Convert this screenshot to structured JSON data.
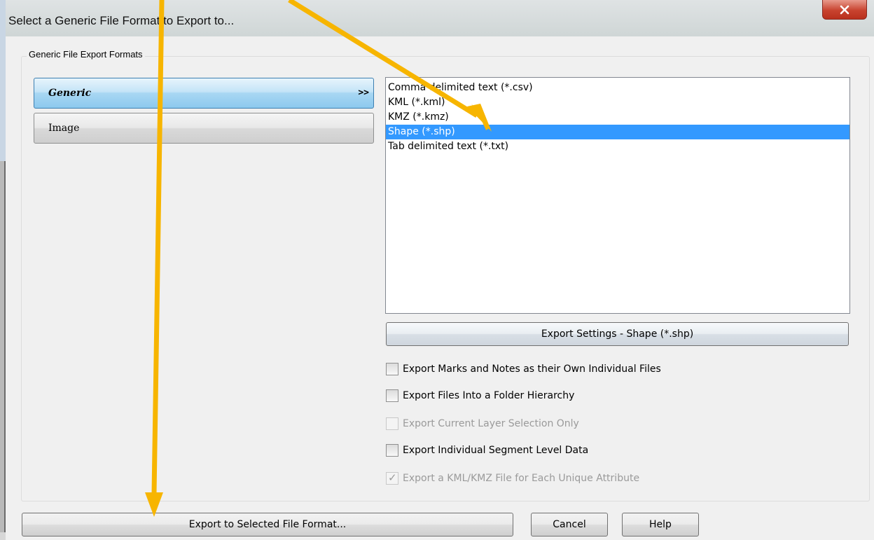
{
  "window": {
    "title": "Select a Generic File Format to Export to...",
    "close_icon": "close-icon"
  },
  "group": {
    "label": "Generic File Export Formats"
  },
  "categories": [
    {
      "label": "Generic",
      "suffix": ">>",
      "selected": true
    },
    {
      "label": "Image",
      "selected": false
    }
  ],
  "formats": [
    {
      "label": "Comma delimited text (*.csv)",
      "selected": false
    },
    {
      "label": "KML (*.kml)",
      "selected": false
    },
    {
      "label": "KMZ (*.kmz)",
      "selected": false
    },
    {
      "label": "Shape (*.shp)",
      "selected": true
    },
    {
      "label": "Tab delimited text (*.txt)",
      "selected": false
    }
  ],
  "export_settings_label": "Export Settings - Shape (*.shp)",
  "options": [
    {
      "label": "Export Marks and Notes as their Own Individual Files",
      "checked": false,
      "enabled": true
    },
    {
      "label": "Export Files Into a Folder Hierarchy",
      "checked": false,
      "enabled": true
    },
    {
      "label": "Export Current Layer Selection Only",
      "checked": false,
      "enabled": false
    },
    {
      "label": "Export Individual Segment Level Data",
      "checked": false,
      "enabled": true
    },
    {
      "label": "Export a KML/KMZ File for Each Unique Attribute",
      "checked": true,
      "enabled": false
    }
  ],
  "buttons": {
    "export": "Export to Selected File Format...",
    "cancel": "Cancel",
    "help": "Help"
  },
  "colors": {
    "selection": "#3399ff",
    "annotation_arrow": "#f7b500",
    "close_button": "#c8432f"
  }
}
